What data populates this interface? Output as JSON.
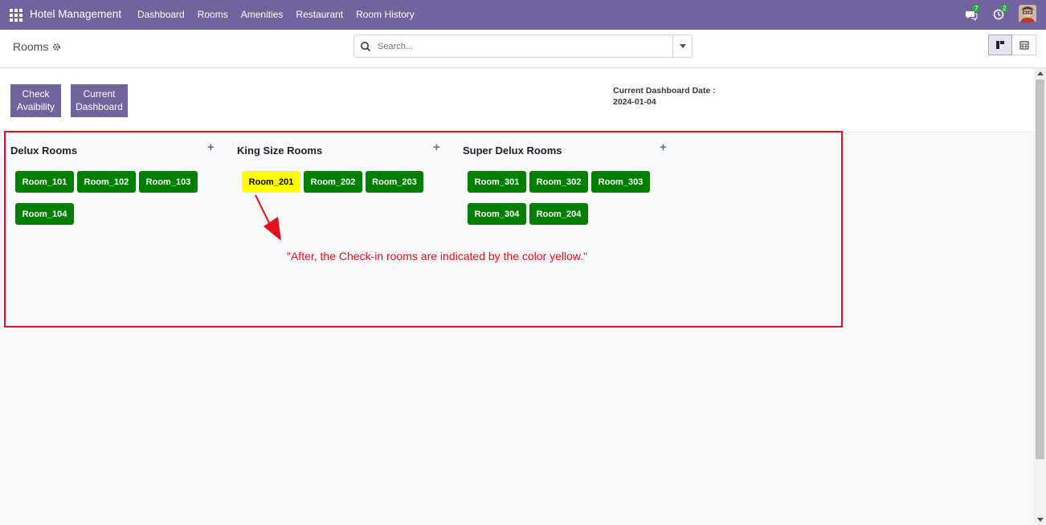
{
  "navbar": {
    "brand": "Hotel Management",
    "menu": [
      "Dashboard",
      "Rooms",
      "Amenities",
      "Restaurant",
      "Room History"
    ],
    "messages_badge": "7",
    "activities_badge": "2",
    "color": "#71639e"
  },
  "control": {
    "breadcrumb": "Rooms",
    "search_placeholder": "Search..."
  },
  "toolbar": {
    "check_label_line1": "Check",
    "check_label_line2": "Avaibility",
    "dashboard_label_line1": "Current",
    "dashboard_label_line2": "Dashboard",
    "date_label": "Current Dashboard Date :",
    "date_value": "2024-01-04"
  },
  "columns": [
    {
      "title": "Delux Rooms",
      "rooms": [
        "Room_101",
        "Room_102",
        "Room_103",
        "Room_104"
      ]
    },
    {
      "title": "King Size Rooms",
      "rooms": [
        "Room_201",
        "Room_202",
        "Room_203"
      ]
    },
    {
      "title": "Super Delux Rooms",
      "rooms": [
        "Room_301",
        "Room_302",
        "Room_303",
        "Room_304",
        "Room_204"
      ]
    }
  ],
  "checked_in_room": "Room_201",
  "annotation": "\"After, the Check-in rooms are indicated by the color yellow.\"",
  "colors": {
    "available": "#008000",
    "checked_in": "#ffff00",
    "annotation": "#e3101a"
  }
}
